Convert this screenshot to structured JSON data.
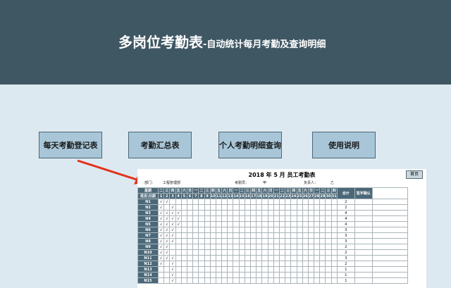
{
  "banner": {
    "title_main": "多岗位考勤表",
    "title_sub": "-自动统计每月考勤及查询明细",
    "bg_color": "#3f5763"
  },
  "nav": [
    {
      "label": "每天考勤登记表"
    },
    {
      "label": "考勤汇总表"
    },
    {
      "label": "个人考勤明细查询"
    },
    {
      "label": "使用说明"
    }
  ],
  "sheet": {
    "title": "2018  年   5   月 员工考勤表",
    "home_button": "首页",
    "dept_label": "部门：",
    "dept_value": "工程管理部",
    "clerk_label": "考勤员：",
    "clerk_value": "甲",
    "owner_label": "负责人：",
    "owner_value": "乙",
    "header_week_label": "星期",
    "header_name_label": "姓名\\日期",
    "total_label": "合计",
    "sign_label": "签字确认",
    "weekdays": [
      "二",
      "三",
      "四",
      "五",
      "六",
      "日",
      "一",
      "二",
      "三",
      "四",
      "五",
      "六",
      "日",
      "一",
      "二",
      "三",
      "四",
      "五",
      "六",
      "日",
      "一",
      "二",
      "三",
      "四",
      "五",
      "六",
      "日",
      "一",
      "二",
      "三",
      "四"
    ],
    "days": [
      "1",
      "2",
      "3",
      "4",
      "5",
      "6",
      "7",
      "8",
      "9",
      "10",
      "11",
      "12",
      "13",
      "14",
      "15",
      "16",
      "17",
      "18",
      "19",
      "20",
      "21",
      "22",
      "23",
      "24",
      "25",
      "26",
      "27",
      "28",
      "29",
      "30",
      "31"
    ],
    "check_mark": "√",
    "rows": [
      {
        "name": "N1",
        "checks": [
          1,
          2
        ],
        "total": "2"
      },
      {
        "name": "N2",
        "checks": [
          1,
          3
        ],
        "total": "2"
      },
      {
        "name": "N3",
        "checks": [
          1,
          2,
          3,
          4
        ],
        "total": "4"
      },
      {
        "name": "N4",
        "checks": [
          1,
          2,
          3,
          4
        ],
        "total": "4"
      },
      {
        "name": "N5",
        "checks": [
          1,
          2,
          3,
          4
        ],
        "total": "4"
      },
      {
        "name": "N6",
        "checks": [
          1,
          2,
          3
        ],
        "total": "3"
      },
      {
        "name": "N7",
        "checks": [
          1,
          2,
          3
        ],
        "total": "3"
      },
      {
        "name": "N8",
        "checks": [
          1,
          2,
          3
        ],
        "total": "3"
      },
      {
        "name": "N9",
        "checks": [
          1,
          2
        ],
        "total": "2"
      },
      {
        "name": "N10",
        "checks": [
          1,
          2
        ],
        "total": "2"
      },
      {
        "name": "N11",
        "checks": [
          1,
          2,
          3
        ],
        "total": "3"
      },
      {
        "name": "N12",
        "checks": [
          1,
          3
        ],
        "total": "2"
      },
      {
        "name": "N13",
        "checks": [
          3
        ],
        "total": "1"
      },
      {
        "name": "N14",
        "checks": [
          3
        ],
        "total": "1"
      },
      {
        "name": "N15",
        "checks": [
          3
        ],
        "total": "1"
      }
    ]
  }
}
